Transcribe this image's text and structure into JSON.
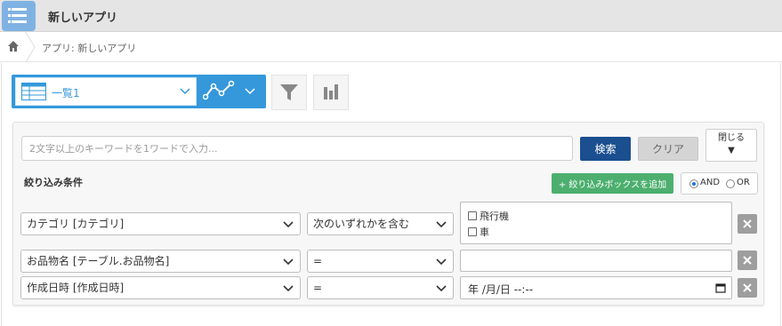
{
  "header": {
    "app_icon": "list-icon",
    "title": "新しいアプリ"
  },
  "breadcrumb": {
    "home_icon": "home-icon",
    "current": "アプリ: 新しいアプリ"
  },
  "view": {
    "icon": "table-icon",
    "selected": "一覧1",
    "graph_icon": "graph-icon",
    "filter_icon": "filter-icon",
    "chart_icon": "bar-chart-icon",
    "accent": "#3498db"
  },
  "search": {
    "placeholder": "2文字以上のキーワードを1ワードで入力...",
    "value": "",
    "search_label": "検索",
    "clear_label": "クリア",
    "close_label": "閉じる",
    "close_arrow": "▼"
  },
  "filters": {
    "heading": "絞り込み条件",
    "add_box_label": "+ 絞り込みボックスを追加",
    "and_label": "AND",
    "or_label": "OR",
    "selected_logic": "AND",
    "rows": [
      {
        "field": "カテゴリ [カテゴリ]",
        "operator": "次のいずれかを含む",
        "options": [
          {
            "label": "飛行機",
            "checked": false
          },
          {
            "label": "車",
            "checked": false
          }
        ]
      },
      {
        "field": "お品物名 [テーブル.お品物名]",
        "operator": "=",
        "value": ""
      },
      {
        "field": "作成日時 [作成日時]",
        "operator": "=",
        "value": "年 /月/日 --:--"
      }
    ]
  },
  "colors": {
    "search_button": "#1b4f8f",
    "add_button": "#4caf6e",
    "delete_button": "#9e9e9e"
  }
}
